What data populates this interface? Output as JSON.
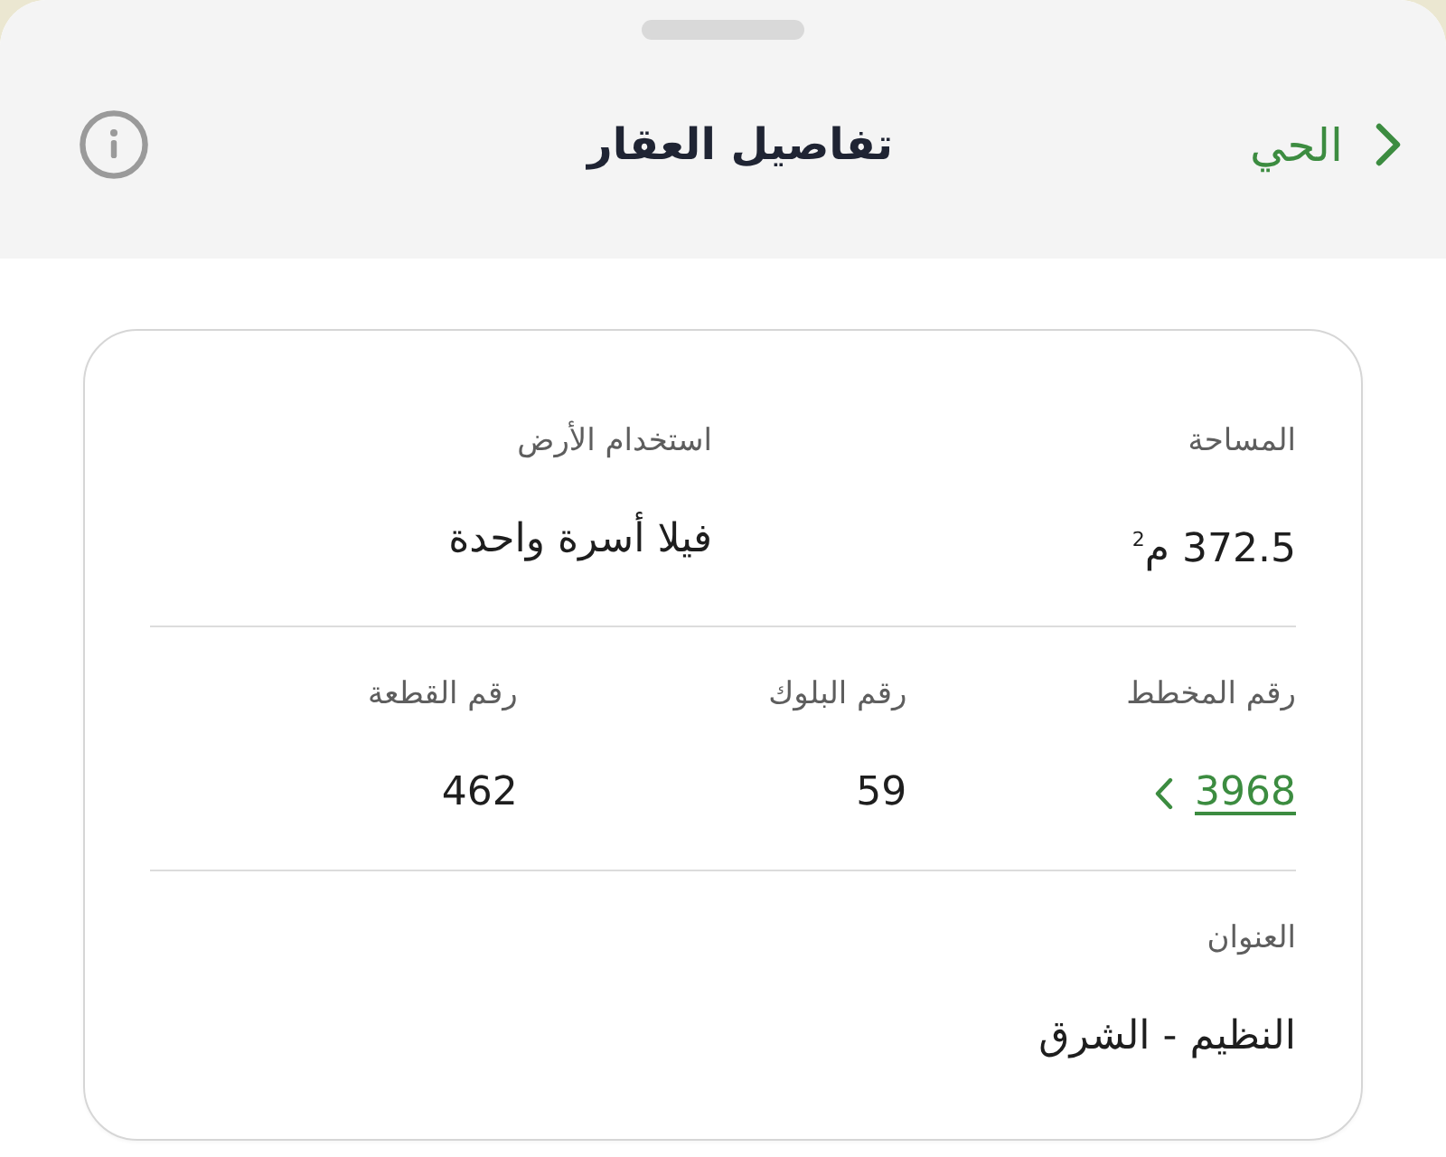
{
  "header": {
    "back_label": "الحي",
    "title": "تفاصيل العقار"
  },
  "details": {
    "rows": [
      {
        "fields": [
          {
            "kind": "text",
            "label": "المساحة",
            "value": "372.5 م$^{2}$"
          },
          {
            "kind": "text",
            "label": "استخدام الأرض",
            "value": "فيلا أسرة واحدة"
          }
        ]
      },
      {
        "fields": [
          {
            "kind": "link",
            "label": "رقم المخطط",
            "value": "3968"
          },
          {
            "kind": "text",
            "label": "رقم البلوك",
            "value": "59"
          },
          {
            "kind": "text",
            "label": "رقم القطعة",
            "value": "462"
          }
        ]
      },
      {
        "fields": [
          {
            "kind": "text",
            "label": "العنوان",
            "value": "النظيم - الشرق"
          }
        ]
      }
    ]
  }
}
